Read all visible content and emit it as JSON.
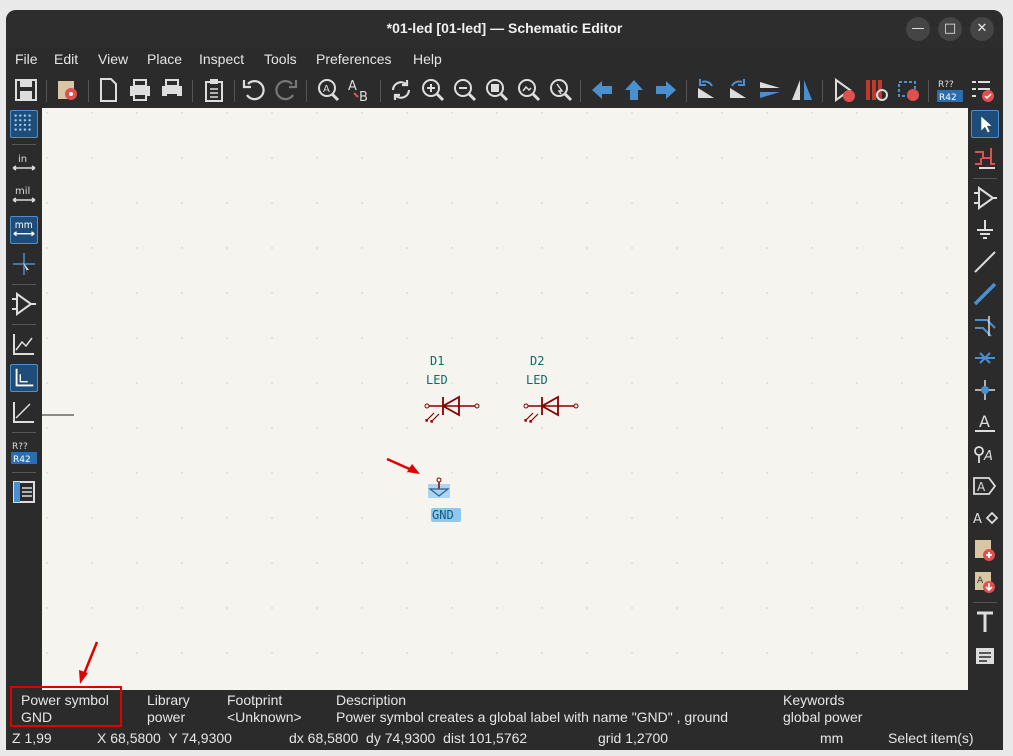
{
  "window": {
    "title": "*01-led [01-led] — Schematic Editor"
  },
  "menu": [
    "File",
    "Edit",
    "View",
    "Place",
    "Inspect",
    "Tools",
    "Preferences",
    "Help"
  ],
  "left_toolbar": {
    "in_label": "in",
    "mil_label": "mil",
    "mm_label": "mm",
    "annotate_top": "R??",
    "annotate_bottom": "R42"
  },
  "top_toolbar": {
    "annotate_top": "R??",
    "annotate_bottom": "R42"
  },
  "schematic": {
    "d1": {
      "ref": "D1",
      "value": "LED"
    },
    "d2": {
      "ref": "D2",
      "value": "LED"
    },
    "gnd": {
      "value": "GND"
    }
  },
  "message_panel": {
    "col1": {
      "header": "Power symbol",
      "value": "GND"
    },
    "col2": {
      "header": "Library",
      "value": "power"
    },
    "col3": {
      "header": "Footprint",
      "value": "<Unknown>"
    },
    "col4": {
      "header": "Description",
      "value": "Power symbol creates a global label with name \"GND\" , ground"
    },
    "col5": {
      "header": "Keywords",
      "value": "global power"
    }
  },
  "status": {
    "zoom": "Z 1,99",
    "xy": "X 68,5800  Y 74,9300",
    "dxy": "dx 68,5800  dy 74,9300  dist 101,5762",
    "grid": "grid 1,2700",
    "units": "mm",
    "mode": "Select item(s)"
  },
  "colors": {
    "accent": "#4a90d0",
    "symbol": "#840000",
    "text": "#0d6b6b",
    "highlight": "#8ec8f0",
    "annotation": "#e00000"
  }
}
